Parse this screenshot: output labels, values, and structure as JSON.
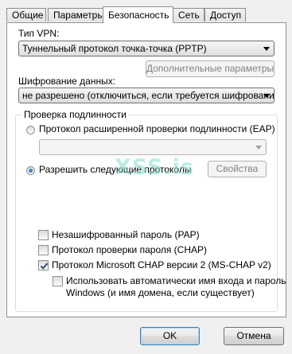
{
  "tabs": [
    {
      "label": "Общие",
      "active": false
    },
    {
      "label": "Параметры",
      "active": false
    },
    {
      "label": "Безопасность",
      "active": true
    },
    {
      "label": "Сеть",
      "active": false
    },
    {
      "label": "Доступ",
      "active": false
    }
  ],
  "vpn_type": {
    "label": "Тип VPN:",
    "value": "Туннельный протокол точка-точка (PPTP)"
  },
  "advanced_button": {
    "label": "Дополнительные параметры",
    "enabled": false
  },
  "encryption": {
    "label": "Шифрование данных:",
    "value": "не разрешено (отключиться, если требуется шифрование)"
  },
  "auth": {
    "group_title": "Проверка подлинности",
    "eap_radio": {
      "label": "Протокол расширенной проверки подлинности (EAP)",
      "checked": false
    },
    "eap_combo": {
      "value": "",
      "enabled": false
    },
    "allow_radio": {
      "label": "Разрешить следующие протоколы",
      "checked": true
    },
    "properties_button": {
      "label": "Свойства",
      "enabled": false
    },
    "protocols": [
      {
        "label": "Незашифрованный пароль (PAP)",
        "checked": false
      },
      {
        "label": "Протокол проверки пароля (CHAP)",
        "checked": false
      },
      {
        "label": "Протокол Microsoft CHAP версии 2 (MS-CHAP v2)",
        "checked": true
      }
    ],
    "auto_logon": {
      "line1": "Использовать автоматически имя входа и пароль",
      "line2": "Windows (и имя домена, если существует)",
      "checked": false
    }
  },
  "watermark": "XSS.is",
  "footer": {
    "ok_label": "OK",
    "cancel_label": "Отмена"
  },
  "colors": {
    "radio_dot": "#1c4e8c",
    "check_mark": "#2a4a7a",
    "watermark": "#82dcc8"
  }
}
